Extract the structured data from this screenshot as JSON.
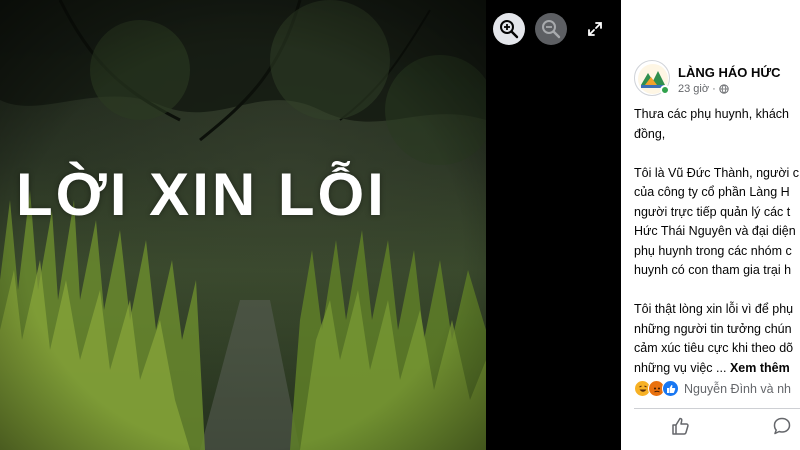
{
  "photo": {
    "overlay_text": "LỜI XIN LỖI"
  },
  "viewer_controls": {
    "zoom_in_icon": "zoom-in-icon",
    "zoom_out_icon": "zoom-out-icon",
    "fullscreen_icon": "fullscreen-icon"
  },
  "post": {
    "page_name": "LÀNG HÁO HỨC",
    "time": "23 giờ ·",
    "privacy_icon": "globe-icon",
    "lines": [
      "Thưa các phụ huynh, khách",
      "đồng,",
      "",
      "Tôi là Vũ Đức Thành, người c",
      "của công ty cổ phần Làng H",
      "người trực tiếp quản lý các t",
      "Hức Thái Nguyên và đại diện",
      "phụ huynh trong các nhóm c",
      "huynh có con tham gia trại h",
      "",
      "Tôi thật lòng xin lỗi vì để phụ",
      "những người tin tưởng chún",
      "cảm xúc tiêu cực khi theo dõ",
      "những vụ việc ..."
    ],
    "see_more": "Xem thêm",
    "reactions": [
      "haha-emoji",
      "angry-emoji",
      "like-emoji"
    ],
    "reactor_names": "Nguyễn Đình và nh",
    "like_icon": "like-icon",
    "comment_icon": "comment-icon"
  },
  "colors": {
    "avatar_online": "#31a24c",
    "like_blue": "#1877f2",
    "muted_text": "#65676b"
  }
}
